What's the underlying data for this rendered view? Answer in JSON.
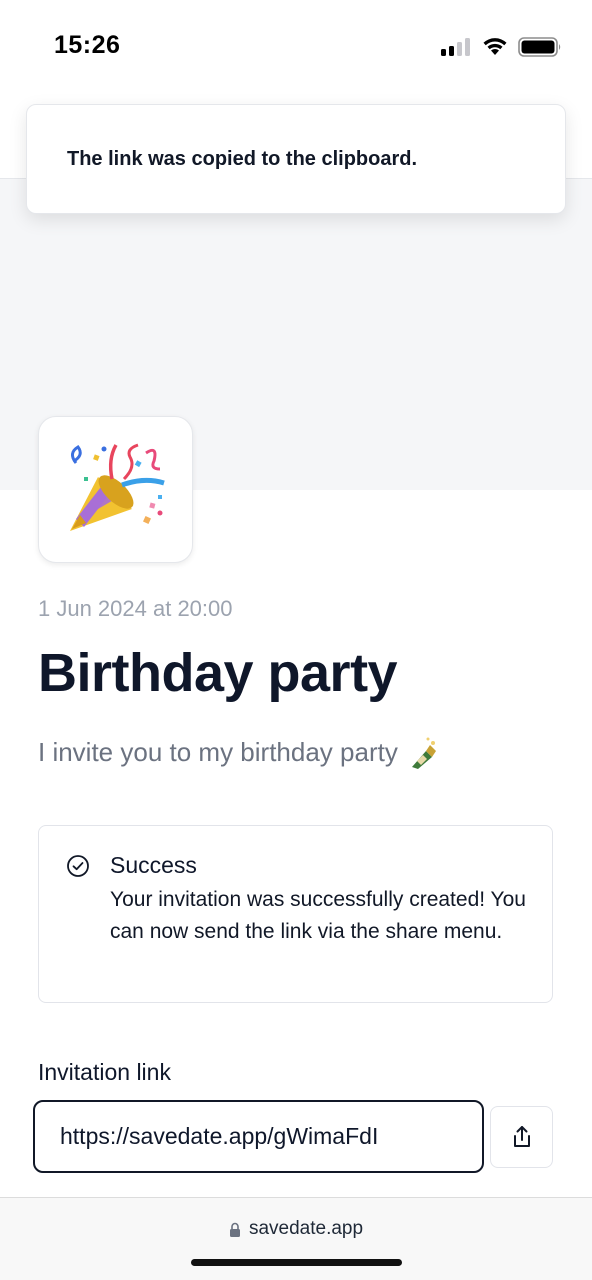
{
  "status_bar": {
    "time": "15:26"
  },
  "toast": {
    "message": "The link was copied to the clipboard."
  },
  "event": {
    "emoji": "party-popper-icon",
    "date": "1 Jun 2024 at 20:00",
    "title": "Birthday party",
    "description": "I invite you to my birthday party",
    "description_emoji": "champagne-icon"
  },
  "alert": {
    "title": "Success",
    "body": "Your invitation was successfully created! You can now send the link via the share menu."
  },
  "invitation": {
    "label": "Invitation link",
    "url": "https://savedate.app/gWimaFdI"
  },
  "browser": {
    "domain": "savedate.app"
  },
  "colors": {
    "text": "#0f172a",
    "muted": "#6b7280",
    "border": "#e2e4ea",
    "hero_bg": "#f5f6f8"
  }
}
